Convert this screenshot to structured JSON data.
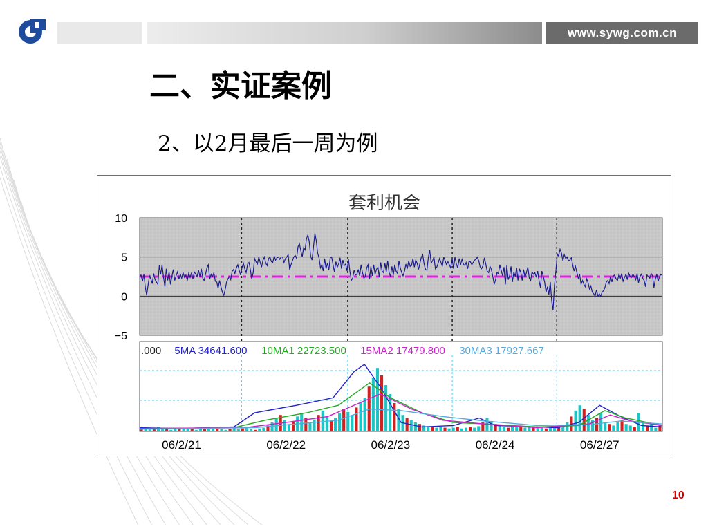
{
  "header": {
    "site_url": "www.sywg.com.cn"
  },
  "slide": {
    "title": "二、实证案例",
    "subtitle": "2、以2月最后一周为例",
    "page_number": "10"
  },
  "colors": {
    "series_line": "#1c1c8c",
    "mean_line": "#e61ee6",
    "plot_bg": "#c4c4c4",
    "ma5": "#2222cc",
    "ma10": "#22aa22",
    "ma15": "#cc22cc",
    "ma30": "#55aadd",
    "volume_red": "#d42020",
    "volume_cyan": "#1cc6c6"
  },
  "chart_data": [
    {
      "type": "line",
      "title": "套利机会",
      "ylim": [
        -5,
        10
      ],
      "yticks": [
        "10",
        "5",
        "0",
        "−5"
      ],
      "ytick_values": [
        10,
        5,
        0,
        -5
      ],
      "grid": true,
      "mean_line": {
        "value": 2.5,
        "style": "dash-dot"
      },
      "session_dividers": [
        0.195,
        0.398,
        0.598,
        0.798
      ],
      "x_range": [
        0,
        100
      ],
      "series": [
        {
          "values": [
            2.5,
            2.7,
            1.9,
            2.8,
            1.2,
            0.1,
            1.4,
            2.6,
            2.2,
            1.6,
            2.9,
            2.1,
            1.8,
            1.5,
            3.9,
            2.8,
            4.0,
            2.4,
            1.2,
            3.5,
            2.0,
            3.1,
            1.5,
            2.5,
            3.4,
            2.0,
            2.6,
            3.1,
            2.2,
            2.8,
            2.3,
            3.0,
            2.4,
            2.7,
            2.0,
            2.9,
            2.4,
            3.0,
            2.2,
            3.1,
            2.8,
            2.5,
            3.3,
            2.5,
            3.5,
            2.3,
            2.0,
            2.8,
            3.6,
            4.0,
            2.2,
            2.8,
            2.5,
            3.0,
            1.9,
            1.8,
            1.0,
            2.0,
            1.2,
            0.5,
            0.1,
            0.8,
            1.8,
            2.2,
            2.5,
            2.1,
            3.2,
            3.4,
            2.9,
            3.6,
            4.0,
            3.3,
            2.7,
            3.6,
            4.2,
            3.5,
            3.0,
            4.1,
            4.3,
            3.4,
            2.2,
            3.0,
            4.8,
            4.4,
            4.1,
            5.0,
            4.3,
            3.7,
            4.6,
            5.0,
            4.2,
            3.9,
            4.8,
            5.0,
            4.4,
            4.3,
            5.1,
            4.6,
            4.9,
            5.0,
            4.7,
            5.0,
            5.0,
            4.3,
            4.8,
            5.0,
            5.3,
            3.4,
            4.0,
            4.5,
            5.0,
            5.2,
            4.8,
            6.3,
            6.7,
            5.8,
            5.0,
            6.2,
            5.9,
            7.3,
            7.8,
            7.0,
            5.1,
            4.6,
            6.2,
            8.0,
            7.1,
            5.5,
            4.9,
            3.6,
            4.0,
            3.2,
            4.8,
            3.5,
            4.2,
            3.3,
            4.9,
            5.0,
            4.0,
            3.1,
            4.4,
            3.7,
            4.1,
            4.9,
            3.5,
            4.6,
            3.9,
            4.1,
            3.2,
            4.7,
            3.2,
            2.0,
            2.3,
            3.3,
            2.7,
            2.8,
            3.4,
            2.6,
            4.0,
            3.0,
            2.3,
            2.5,
            3.6,
            4.0,
            2.2,
            3.8,
            2.6,
            4.0,
            2.8,
            3.4,
            3.7,
            2.4,
            4.3,
            3.2,
            3.0,
            4.2,
            3.1,
            4.5,
            3.0,
            2.5,
            3.8,
            2.7,
            4.0,
            3.2,
            2.9,
            4.5,
            3.6,
            3.0,
            2.6,
            3.2,
            4.1,
            3.5,
            4.5,
            3.8,
            3.9,
            4.8,
            3.7,
            4.6,
            4.2,
            3.4,
            4.2,
            5.0,
            5.3,
            4.1,
            3.4,
            3.3,
            4.9,
            5.9,
            4.2,
            4.5,
            5.0,
            3.5,
            3.7,
            4.2,
            4.8,
            4.3,
            3.8,
            5.0,
            4.5,
            4.0,
            4.4,
            4.0,
            3.6,
            4.8,
            3.5,
            5.0,
            4.1,
            3.6,
            4.8,
            4.0,
            4.7,
            4.1,
            3.9,
            4.3,
            3.5,
            4.4,
            4.4,
            4.0,
            4.3,
            4.6,
            4.7,
            5.0,
            4.5,
            3.7,
            3.5,
            3.9,
            4.9,
            4.1,
            3.2,
            3.0,
            3.8,
            3.4,
            2.5,
            1.5,
            2.1,
            3.0,
            2.9,
            4.0,
            3.3,
            2.6,
            3.7,
            1.5,
            3.9,
            2.1,
            2.6,
            3.8,
            1.8,
            3.1,
            2.5,
            3.6,
            2.0,
            3.5,
            3.0,
            2.0,
            3.4,
            2.4,
            3.0,
            3.7,
            2.3,
            2.0,
            3.1,
            2.8,
            3.0,
            2.4,
            3.2,
            2.0,
            1.1,
            3.2,
            2.5,
            1.8,
            0.5,
            1.2,
            0.2,
            1.8,
            -0.6,
            -1.8,
            1.4,
            3.2,
            5.4,
            5.1,
            6.0,
            5.5,
            4.5,
            5.3,
            4.8,
            5.0,
            4.5,
            4.6,
            4.9,
            4.0,
            3.2,
            3.8,
            3.0,
            2.3,
            2.8,
            1.5,
            2.0,
            1.5,
            1.2,
            2.2,
            1.7,
            0.9,
            1.3,
            0.5,
            0.3,
            0.0,
            0.8,
            0.0,
            0.3,
            0.0,
            0.5,
            0.7,
            1.1,
            1.8,
            2.0,
            1.6,
            2.5,
            1.8,
            2.6,
            2.7,
            2.2,
            2.0,
            2.8,
            2.3,
            2.9,
            1.9,
            2.4,
            2.8,
            2.1,
            2.9,
            2.5,
            2.4,
            2.8,
            2.5,
            2.1,
            2.9,
            1.7,
            2.5,
            2.8,
            2.3,
            2.0,
            1.2,
            2.7,
            2.5,
            2.3,
            2.9,
            2.6,
            1.1,
            2.2,
            2.8,
            1.9,
            2.5,
            2.8,
            2.6
          ]
        }
      ]
    },
    {
      "type": "bar",
      "legend": [
        {
          "name": ".000",
          "color": "#1c1c1c"
        },
        {
          "name": "5MA 34641.600",
          "color": "#2222cc"
        },
        {
          "name": "10MA1 22723.500",
          "color": "#22aa22"
        },
        {
          "name": "15MA2 17479.800",
          "color": "#cc22cc"
        },
        {
          "name": "30MA3 17927.667",
          "color": "#55aadd"
        }
      ],
      "xticklabels": [
        "06/2/21",
        "06/2/22",
        "06/2/23",
        "06/2/24",
        "06/2/27"
      ],
      "xtick_positions": [
        0.08,
        0.28,
        0.48,
        0.68,
        0.88
      ],
      "session_dividers": [
        0.195,
        0.398,
        0.598,
        0.798
      ],
      "x_range": [
        0,
        100
      ],
      "volume_relative": [
        0.05,
        0.03,
        0.04,
        0.04,
        0.06,
        0.03,
        0.05,
        0.02,
        0.04,
        0.03,
        0.05,
        0.04,
        0.03,
        0.02,
        0.04,
        0.03,
        0.05,
        0.06,
        0.04,
        0.03,
        0.02,
        0.03,
        0.05,
        0.03,
        0.04,
        0.06,
        0.03,
        0.02,
        0.04,
        0.05,
        0.08,
        0.12,
        0.18,
        0.22,
        0.15,
        0.1,
        0.14,
        0.2,
        0.25,
        0.18,
        0.12,
        0.16,
        0.22,
        0.28,
        0.2,
        0.15,
        0.18,
        0.24,
        0.3,
        0.26,
        0.22,
        0.32,
        0.4,
        0.45,
        0.6,
        0.72,
        0.85,
        0.75,
        0.62,
        0.5,
        0.38,
        0.3,
        0.22,
        0.18,
        0.15,
        0.12,
        0.1,
        0.08,
        0.07,
        0.06,
        0.05,
        0.06,
        0.05,
        0.04,
        0.05,
        0.06,
        0.04,
        0.05,
        0.06,
        0.05,
        0.07,
        0.12,
        0.18,
        0.14,
        0.1,
        0.08,
        0.06,
        0.05,
        0.07,
        0.06,
        0.08,
        0.05,
        0.06,
        0.07,
        0.05,
        0.06,
        0.04,
        0.05,
        0.07,
        0.06,
        0.08,
        0.12,
        0.2,
        0.28,
        0.35,
        0.3,
        0.22,
        0.15,
        0.18,
        0.25,
        0.12,
        0.1,
        0.08,
        0.12,
        0.15,
        0.1,
        0.08,
        0.06,
        0.25,
        0.12,
        0.08,
        0.1,
        0.05,
        0.08
      ],
      "ma_lines": [
        {
          "name": "5MA",
          "color": "#2222cc",
          "points": [
            [
              0,
              0.05
            ],
            [
              8,
              0.04
            ],
            [
              18,
              0.06
            ],
            [
              22,
              0.25
            ],
            [
              30,
              0.35
            ],
            [
              37,
              0.45
            ],
            [
              41,
              0.8
            ],
            [
              43,
              0.9
            ],
            [
              46,
              0.6
            ],
            [
              50,
              0.12
            ],
            [
              54,
              0.06
            ],
            [
              60,
              0.08
            ],
            [
              65,
              0.18
            ],
            [
              68,
              0.08
            ],
            [
              76,
              0.06
            ],
            [
              80,
              0.05
            ],
            [
              84,
              0.12
            ],
            [
              88,
              0.35
            ],
            [
              92,
              0.2
            ],
            [
              96,
              0.08
            ],
            [
              100,
              0.06
            ]
          ]
        },
        {
          "name": "10MA1",
          "color": "#22aa22",
          "points": [
            [
              0,
              0.04
            ],
            [
              18,
              0.05
            ],
            [
              24,
              0.15
            ],
            [
              32,
              0.25
            ],
            [
              38,
              0.35
            ],
            [
              42,
              0.55
            ],
            [
              44,
              0.65
            ],
            [
              48,
              0.45
            ],
            [
              54,
              0.25
            ],
            [
              60,
              0.12
            ],
            [
              66,
              0.1
            ],
            [
              76,
              0.06
            ],
            [
              84,
              0.08
            ],
            [
              89,
              0.28
            ],
            [
              93,
              0.18
            ],
            [
              100,
              0.08
            ]
          ]
        },
        {
          "name": "15MA2",
          "color": "#cc22cc",
          "points": [
            [
              0,
              0.04
            ],
            [
              20,
              0.05
            ],
            [
              28,
              0.12
            ],
            [
              36,
              0.2
            ],
            [
              42,
              0.38
            ],
            [
              46,
              0.5
            ],
            [
              52,
              0.3
            ],
            [
              58,
              0.15
            ],
            [
              66,
              0.1
            ],
            [
              76,
              0.05
            ],
            [
              86,
              0.1
            ],
            [
              90,
              0.22
            ],
            [
              94,
              0.14
            ],
            [
              100,
              0.08
            ]
          ]
        },
        {
          "name": "30MA3",
          "color": "#55aadd",
          "points": [
            [
              0,
              0.03
            ],
            [
              22,
              0.05
            ],
            [
              30,
              0.1
            ],
            [
              38,
              0.15
            ],
            [
              44,
              0.3
            ],
            [
              50,
              0.28
            ],
            [
              58,
              0.2
            ],
            [
              66,
              0.14
            ],
            [
              76,
              0.08
            ],
            [
              86,
              0.09
            ],
            [
              92,
              0.14
            ],
            [
              100,
              0.1
            ]
          ]
        }
      ]
    }
  ]
}
